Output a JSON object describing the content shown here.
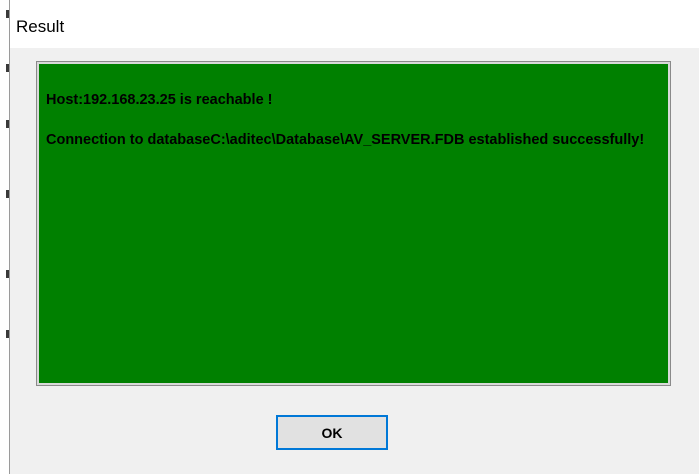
{
  "window": {
    "title": "Result"
  },
  "result": {
    "line1": "Host:192.168.23.25 is reachable !",
    "line2": "Connection to databaseC:\\aditec\\Database\\AV_SERVER.FDB established successfully!",
    "background_color": "#008000"
  },
  "buttons": {
    "ok_label": "OK"
  }
}
